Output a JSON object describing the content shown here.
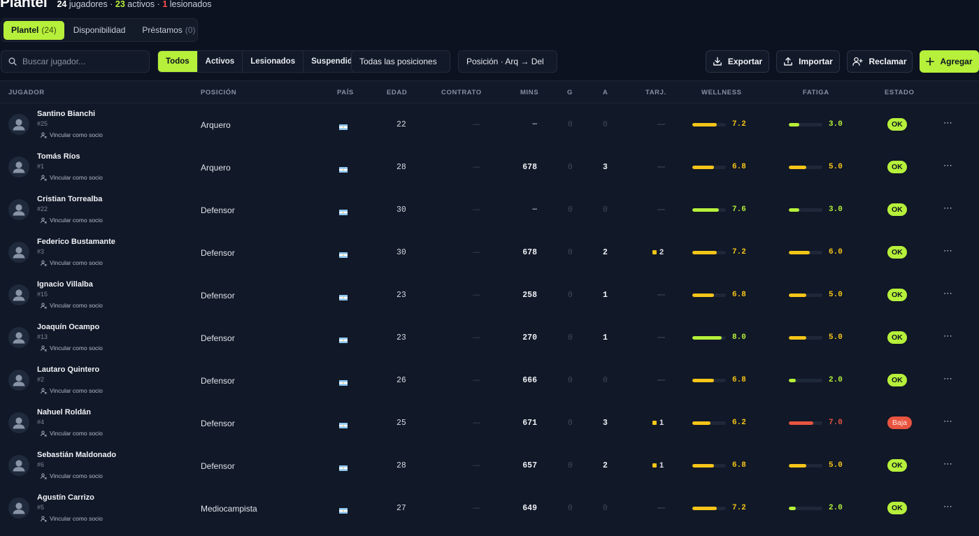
{
  "header": {
    "title": "Plantel",
    "summary": {
      "players_count": "24",
      "players_label": "jugadores ·",
      "active_count": "23",
      "active_label": "activos ·",
      "injured_count": "1",
      "injured_label": "lesionados"
    }
  },
  "tabs": [
    {
      "label": "Plantel",
      "count": "(24)"
    },
    {
      "label": "Disponibilidad",
      "count": ""
    },
    {
      "label": "Préstamos",
      "count": "(0)"
    }
  ],
  "toolbar": {
    "search_placeholder": "Buscar jugador...",
    "filters": [
      "Todos",
      "Activos",
      "Lesionados",
      "Suspendidos"
    ],
    "positions_dropdown": "Todas las posiciones",
    "sort_dropdown": "Posición · Arq → Del",
    "export_label": "Exportar",
    "import_label": "Importar",
    "claim_label": "Reclamar",
    "add_label": "Agregar"
  },
  "columns": [
    "JUGADOR",
    "POSICIÓN",
    "PAÍS",
    "EDAD",
    "CONTRATO",
    "MINS",
    "G",
    "A",
    "TARJ.",
    "WELLNESS",
    "FATIGA",
    "ESTADO"
  ],
  "link_label": "Vincular como socio",
  "colors": {
    "accent": "#b6f03a",
    "yellow": "#f5c518",
    "red": "#e8543f"
  },
  "players": [
    {
      "name": "Santino Bianchi",
      "number": "#25",
      "position": "Arquero",
      "age": "22",
      "contract": "—",
      "mins": "—",
      "goals": "0",
      "assists": "0",
      "cards": "—",
      "wellness": "7.2",
      "fatigue": "3.0",
      "status": "OK"
    },
    {
      "name": "Tomás Ríos",
      "number": "#1",
      "position": "Arquero",
      "age": "28",
      "contract": "—",
      "mins": "678",
      "goals": "0",
      "assists": "3",
      "cards": "—",
      "wellness": "6.8",
      "fatigue": "5.0",
      "status": "OK"
    },
    {
      "name": "Cristian Torrealba",
      "number": "#22",
      "position": "Defensor",
      "age": "30",
      "contract": "—",
      "mins": "—",
      "goals": "0",
      "assists": "0",
      "cards": "—",
      "wellness": "7.6",
      "fatigue": "3.0",
      "status": "OK"
    },
    {
      "name": "Federico Bustamante",
      "number": "#3",
      "position": "Defensor",
      "age": "30",
      "contract": "—",
      "mins": "678",
      "goals": "0",
      "assists": "2",
      "cards": "2",
      "wellness": "7.2",
      "fatigue": "6.0",
      "status": "OK"
    },
    {
      "name": "Ignacio Villalba",
      "number": "#15",
      "position": "Defensor",
      "age": "23",
      "contract": "—",
      "mins": "258",
      "goals": "0",
      "assists": "1",
      "cards": "—",
      "wellness": "6.8",
      "fatigue": "5.0",
      "status": "OK"
    },
    {
      "name": "Joaquín Ocampo",
      "number": "#13",
      "position": "Defensor",
      "age": "23",
      "contract": "—",
      "mins": "270",
      "goals": "0",
      "assists": "1",
      "cards": "—",
      "wellness": "8.0",
      "fatigue": "5.0",
      "status": "OK"
    },
    {
      "name": "Lautaro Quintero",
      "number": "#2",
      "position": "Defensor",
      "age": "26",
      "contract": "—",
      "mins": "666",
      "goals": "0",
      "assists": "0",
      "cards": "—",
      "wellness": "6.8",
      "fatigue": "2.0",
      "status": "OK"
    },
    {
      "name": "Nahuel Roldán",
      "number": "#4",
      "position": "Defensor",
      "age": "25",
      "contract": "—",
      "mins": "671",
      "goals": "0",
      "assists": "3",
      "cards": "1",
      "wellness": "6.2",
      "fatigue": "7.0",
      "status": "Baja"
    },
    {
      "name": "Sebastián Maldonado",
      "number": "#6",
      "position": "Defensor",
      "age": "28",
      "contract": "—",
      "mins": "657",
      "goals": "0",
      "assists": "2",
      "cards": "1",
      "wellness": "6.8",
      "fatigue": "5.0",
      "status": "OK"
    },
    {
      "name": "Agustín Carrizo",
      "number": "#5",
      "position": "Mediocampista",
      "age": "27",
      "contract": "—",
      "mins": "649",
      "goals": "0",
      "assists": "0",
      "cards": "—",
      "wellness": "7.2",
      "fatigue": "2.0",
      "status": "OK"
    }
  ]
}
